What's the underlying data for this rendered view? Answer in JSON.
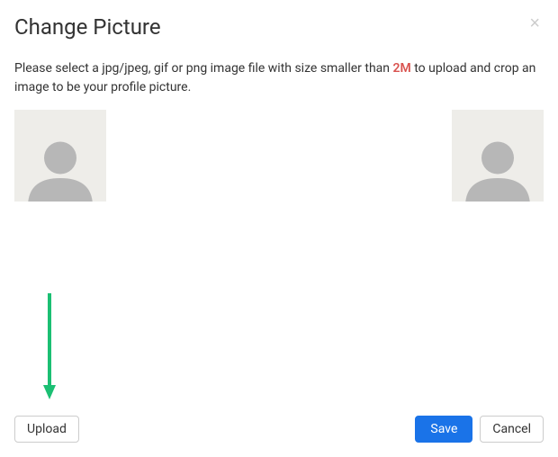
{
  "modal": {
    "title": "Change Picture",
    "instruction_prefix": "Please select a jpg/jpeg, gif or png image file with size smaller than ",
    "instruction_size": "2M",
    "instruction_suffix": " to upload and crop an image to be your profile picture."
  },
  "buttons": {
    "upload": "Upload",
    "save": "Save",
    "cancel": "Cancel"
  },
  "colors": {
    "primary": "#1a73e8",
    "danger": "#d9534f",
    "avatar_bg": "#eeede9",
    "avatar_fg": "#b7b7b7",
    "annotation": "#1bbf73"
  }
}
